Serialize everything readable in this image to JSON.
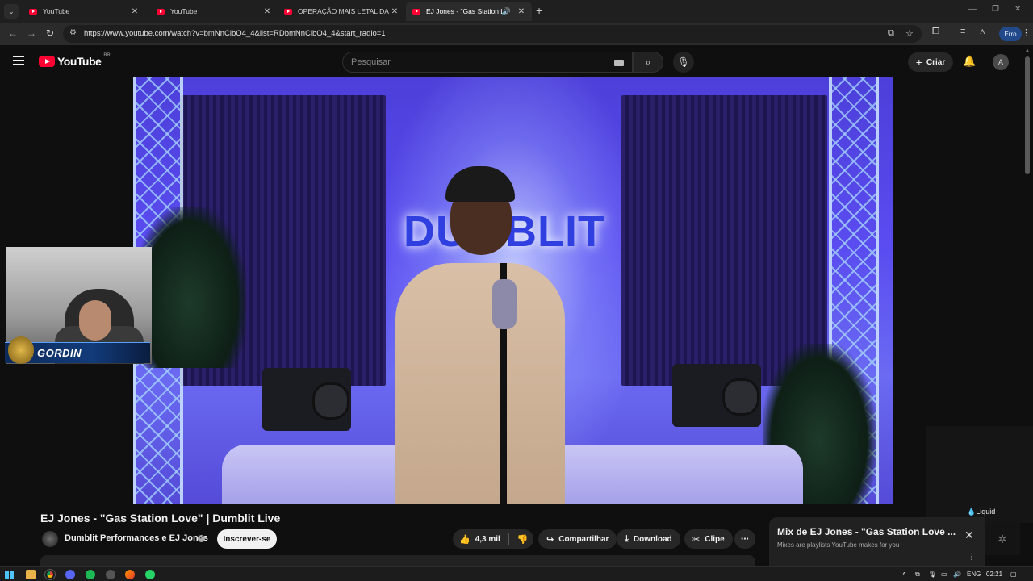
{
  "tabs": [
    {
      "title": "YouTube"
    },
    {
      "title": "YouTube"
    },
    {
      "title": "OPERAÇÃO MAIS LETAL DA HIS"
    },
    {
      "title": "EJ Jones - \"Gas Station Love"
    }
  ],
  "address": {
    "url": "https://www.youtube.com/watch?v=bmNnClbO4_4&list=RDbmNnClbO4_4&start_radio=1"
  },
  "profile": {
    "status": "Erro"
  },
  "youtube": {
    "logo_text": "YouTube",
    "country": "BR",
    "search_placeholder": "Pesquisar",
    "create_label": "Criar"
  },
  "video": {
    "neon_sign": "DUMBLIT",
    "overlay_name": "GORDIN"
  },
  "info": {
    "title": "EJ Jones - \"Gas Station Love\" | Dumblit Live",
    "channel": "Dumblit Performances e EJ Jones",
    "subscribe": "Inscrever-se",
    "likes": "4,3 mil",
    "share": "Compartilhar",
    "download": "Download",
    "clip": "Clipe"
  },
  "mix": {
    "title": "Mix de EJ Jones - \"Gas Station Love ...",
    "subtitle": "Mixes are playlists YouTube makes for you",
    "side_label": "Liquid"
  },
  "taskbar": {
    "lang": "ENG",
    "time": "02:21"
  },
  "colors": {
    "brand_red": "#ff0033",
    "page_bg": "#0f0f0f"
  }
}
